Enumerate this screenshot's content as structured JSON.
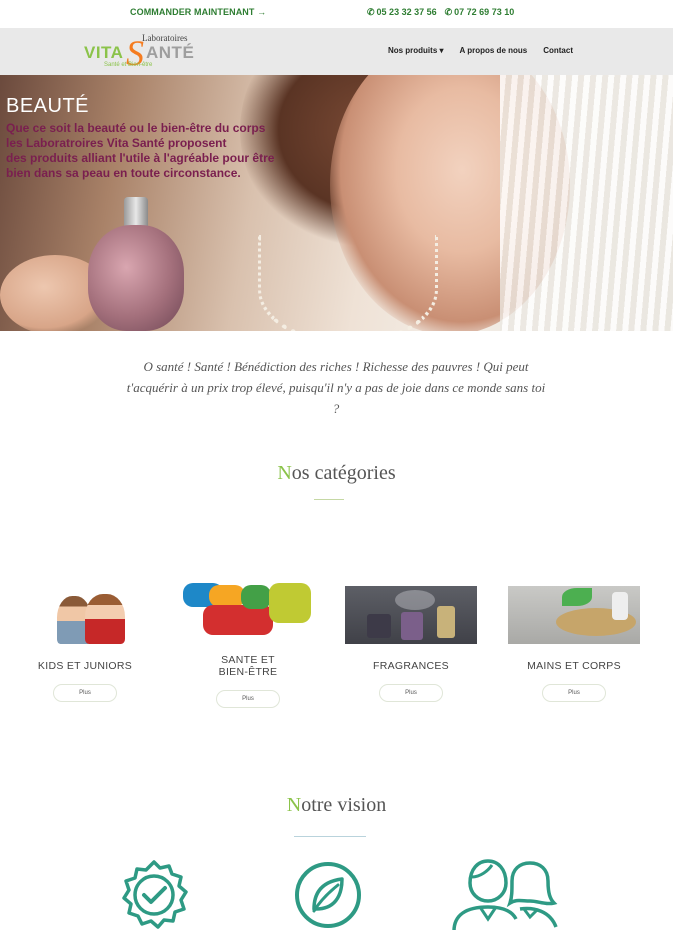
{
  "topbar": {
    "order_label": "COMMANDER MAINTENANT →",
    "phone1": "05 23 32 37 56",
    "phone2": "07 72 69 73 10"
  },
  "logo": {
    "laboratoires": "Laboratoires",
    "vita": "VITA",
    "sante": "ANTÉ",
    "subtitle": "Santé et   Bien-être"
  },
  "nav": {
    "items": [
      {
        "label": "Nos produits ▾"
      },
      {
        "label": "A propos de nous"
      },
      {
        "label": "Contact"
      }
    ]
  },
  "hero": {
    "title": "BEAUTÉ",
    "lines": [
      "Que ce soit la beauté ou le bien-être du corps",
      "les Laboratroires Vita Santé proposent",
      "des produits alliant l'utile à l'agréable pour être",
      "bien dans sa peau en toute circonstance."
    ]
  },
  "quote": "O santé ! Santé ! Bénédiction des riches ! Richesse des pauvres ! Qui peut t'acquérir à un prix trop élevé, puisqu'il n'y a pas de joie dans ce monde sans toi ?",
  "categories": {
    "title_first": "N",
    "title_rest": "os catégories",
    "items": [
      {
        "label": "KIDS ET JUNIORS",
        "more": "Plus"
      },
      {
        "label_line1": "SANTE ET",
        "label_line2": "BIEN-ÊTRE",
        "more": "Plus"
      },
      {
        "label": "FRAGRANCES",
        "more": "Plus"
      },
      {
        "label": "MAINS ET CORPS",
        "more": "Plus"
      }
    ]
  },
  "vision": {
    "title_first": "N",
    "title_rest": "otre vision"
  },
  "colors": {
    "brand_green": "#2e7d32",
    "accent_green": "#8bc34a",
    "hero_text": "#7a1f4f",
    "icon_teal": "#2e9a84"
  }
}
